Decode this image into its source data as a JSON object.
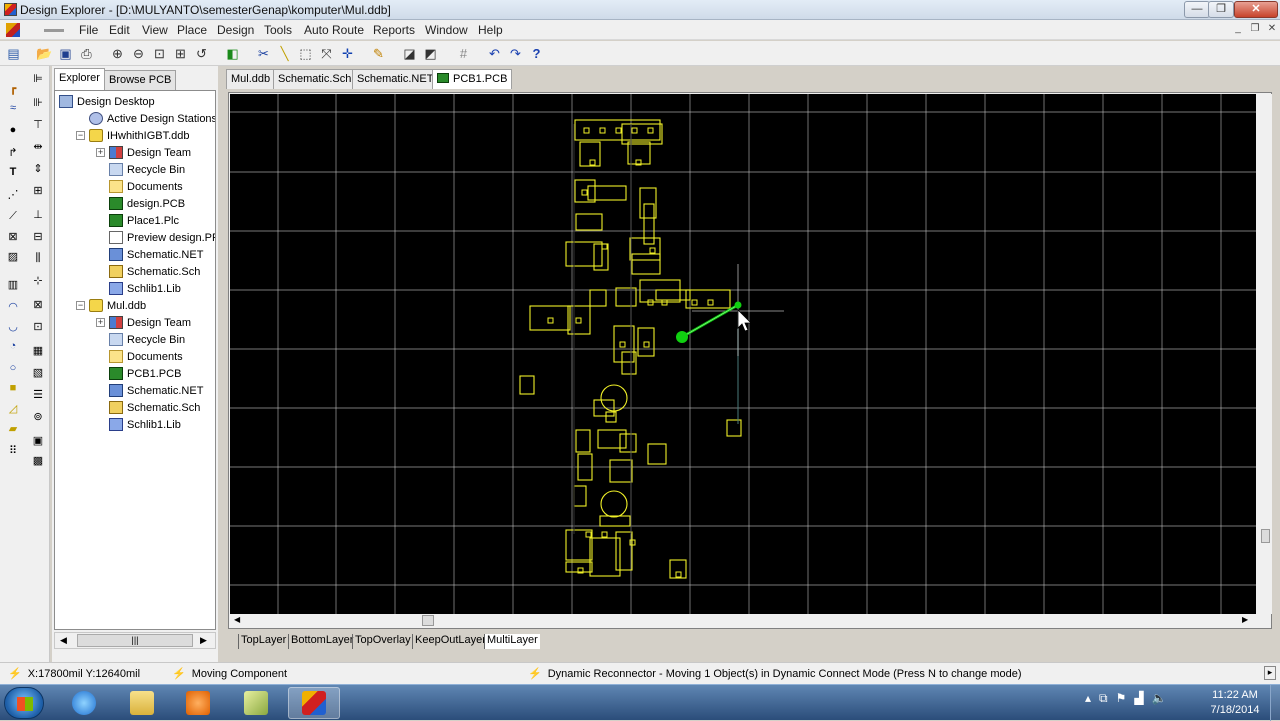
{
  "window": {
    "title": "Design Explorer - [D:\\MULYANTO\\semesterGenap\\komputer\\Mul.ddb]",
    "min_label": "—",
    "max_label": "❐",
    "close_label": "✕"
  },
  "menu": {
    "items": [
      "File",
      "Edit",
      "View",
      "Place",
      "Design",
      "Tools",
      "Auto Route",
      "Reports",
      "Window",
      "Help"
    ]
  },
  "explorer": {
    "tabs": [
      "Explorer",
      "Browse PCB"
    ],
    "active_tab": "Explorer",
    "tree": [
      {
        "label": "Design Desktop",
        "icon": "desktop",
        "depth": 0
      },
      {
        "label": "Active Design Stations",
        "icon": "stations",
        "depth": 1
      },
      {
        "label": "IHwhithIGBT.ddb",
        "icon": "db",
        "depth": 1,
        "expander": "−"
      },
      {
        "label": "Design Team",
        "icon": "team",
        "depth": 2,
        "expander": "+"
      },
      {
        "label": "Recycle Bin",
        "icon": "bin",
        "depth": 2
      },
      {
        "label": "Documents",
        "icon": "folder",
        "depth": 2
      },
      {
        "label": "design.PCB",
        "icon": "pcb",
        "depth": 2
      },
      {
        "label": "Place1.Plc",
        "icon": "pcb",
        "depth": 2
      },
      {
        "label": "Preview design.PPC",
        "icon": "doc",
        "depth": 2
      },
      {
        "label": "Schematic.NET",
        "icon": "net",
        "depth": 2
      },
      {
        "label": "Schematic.Sch",
        "icon": "sch",
        "depth": 2
      },
      {
        "label": "Schlib1.Lib",
        "icon": "lib",
        "depth": 2
      },
      {
        "label": "Mul.ddb",
        "icon": "db",
        "depth": 1,
        "expander": "−"
      },
      {
        "label": "Design Team",
        "icon": "team",
        "depth": 2,
        "expander": "+"
      },
      {
        "label": "Recycle Bin",
        "icon": "bin",
        "depth": 2
      },
      {
        "label": "Documents",
        "icon": "folder",
        "depth": 2
      },
      {
        "label": "PCB1.PCB",
        "icon": "pcb",
        "depth": 2
      },
      {
        "label": "Schematic.NET",
        "icon": "net",
        "depth": 2
      },
      {
        "label": "Schematic.Sch",
        "icon": "sch",
        "depth": 2
      },
      {
        "label": "Schlib1.Lib",
        "icon": "lib",
        "depth": 2
      }
    ]
  },
  "doc_tabs": [
    "Mul.ddb",
    "Schematic.Sch",
    "Schematic.NET",
    "PCB1.PCB"
  ],
  "active_doc_tab": "PCB1.PCB",
  "layers": [
    "TopLayer",
    "BottomLayer",
    "TopOverlay",
    "KeepOutLayer",
    "MultiLayer"
  ],
  "active_layer": "MultiLayer",
  "status": {
    "coords": "X:17800mil Y:12640mil",
    "mode": "Moving Component",
    "message": "Dynamic Reconnector - Moving 1 Object(s) in Dynamic Connect Mode (Press N to change mode)"
  },
  "taskbar": {
    "time": "11:22 AM",
    "date": "7/18/2014"
  },
  "colors": {
    "canvas_bg": "#000000",
    "grid": "#c8c8c8",
    "overlay": "#f0f028",
    "connection": "#10d010"
  },
  "icons": {
    "toolbar": [
      "project-icon",
      "open-icon",
      "save-icon",
      "print-icon",
      "zoom-in-icon",
      "zoom-out-icon",
      "zoom-fit-icon",
      "zoom-area-icon",
      "zoom-prev-icon",
      "browse-icon",
      "cut-icon",
      "wire-icon",
      "select-icon",
      "deselect-icon",
      "move-icon",
      "cross-icon",
      "pencil-icon",
      "library-icon",
      "library-browse-icon",
      "grid-icon",
      "undo-icon",
      "redo-icon",
      "help-icon"
    ]
  }
}
